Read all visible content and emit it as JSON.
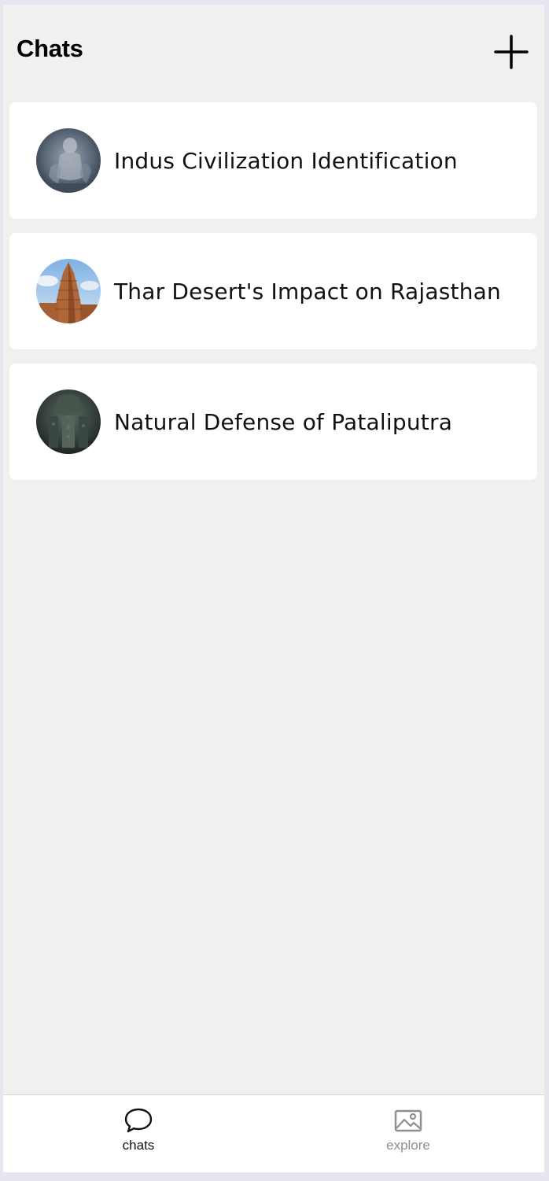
{
  "header": {
    "title": "Chats",
    "add_icon": "plus-icon"
  },
  "chats": [
    {
      "title": "Indus Civilization Identification",
      "avatar": "stone-carving-thumbnail"
    },
    {
      "title": "Thar Desert's Impact on Rajasthan",
      "avatar": "temple-tower-thumbnail"
    },
    {
      "title": "Natural Defense of Pataliputra",
      "avatar": "dark-sculpture-thumbnail"
    }
  ],
  "tabbar": {
    "tabs": [
      {
        "label": "chats",
        "icon": "chat-bubble-icon",
        "active": true
      },
      {
        "label": "explore",
        "icon": "image-icon",
        "active": false
      }
    ]
  },
  "colors": {
    "background": "#f0f0f1",
    "card": "#ffffff",
    "active_tab": "#111111",
    "inactive_tab": "#8e8e93"
  }
}
